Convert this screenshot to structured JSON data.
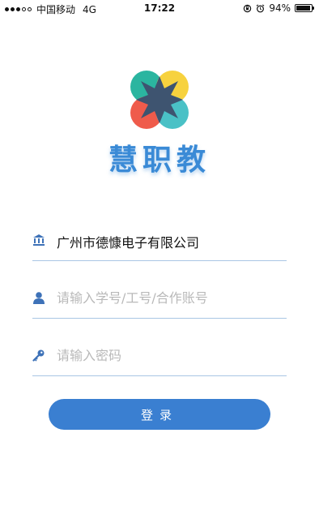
{
  "status_bar": {
    "carrier": "中国移动",
    "network": "4G",
    "time": "17:22",
    "battery_percent": "94%",
    "battery_level": 0.94
  },
  "app": {
    "title": "慧职教",
    "logo_colors": [
      "#2bb5a0",
      "#f7d23e",
      "#ef5b4b",
      "#4ac1c6",
      "#3e5470"
    ]
  },
  "form": {
    "organization": {
      "icon": "institution-icon",
      "value": "广州市德慷电子有限公司"
    },
    "username": {
      "icon": "user-icon",
      "placeholder": "请输入学号/工号/合作账号"
    },
    "password": {
      "icon": "key-icon",
      "placeholder": "请输入密码"
    },
    "login_label": "登录"
  },
  "colors": {
    "primary": "#3a7fd1",
    "divider": "#a9c6e4",
    "icon": "#3e72b8"
  }
}
